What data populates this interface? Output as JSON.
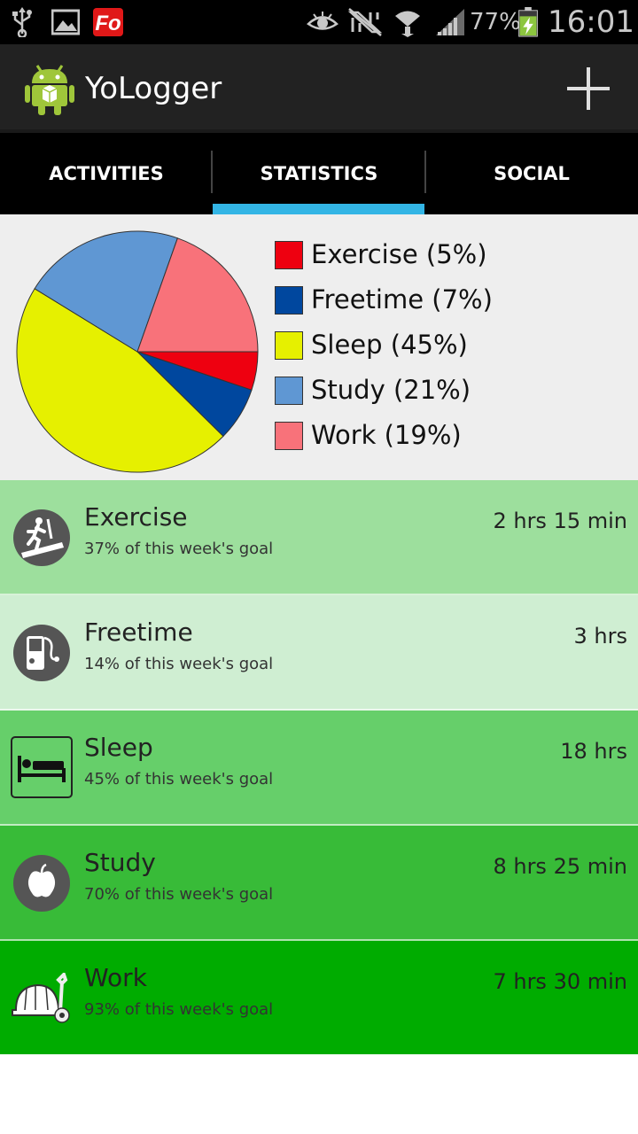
{
  "status_bar": {
    "battery": "77%",
    "time": "16:01",
    "icons": [
      "usb-icon",
      "gallery-icon",
      "fo-app-icon",
      "eye-icon",
      "nfc-icon",
      "wifi-icon",
      "signal-icon",
      "battery-charging-icon"
    ]
  },
  "app": {
    "title": "YoLogger",
    "add_icon": "plus-icon"
  },
  "tabs": [
    {
      "label": "ACTIVITIES",
      "selected": false
    },
    {
      "label": "STATISTICS",
      "selected": true
    },
    {
      "label": "SOCIAL",
      "selected": false
    }
  ],
  "colors": {
    "accent": "#33b5e5",
    "exercise": "#ee0010",
    "freetime": "#00479e",
    "sleep": "#e6f000",
    "study": "#5f97d3",
    "work": "#f8727a"
  },
  "chart_data": {
    "type": "pie",
    "slices": [
      {
        "label": "Exercise (5%)",
        "name": "Exercise",
        "value": 5,
        "color": "#ee0010"
      },
      {
        "label": "Freetime (7%)",
        "name": "Freetime",
        "value": 7,
        "color": "#00479e"
      },
      {
        "label": "Sleep (45%)",
        "name": "Sleep",
        "value": 45,
        "color": "#e6f000"
      },
      {
        "label": "Study (21%)",
        "name": "Study",
        "value": 21,
        "color": "#5f97d3"
      },
      {
        "label": "Work (19%)",
        "name": "Work",
        "value": 19,
        "color": "#f8727a"
      }
    ],
    "legend_position": "right"
  },
  "activities": [
    {
      "name": "Exercise",
      "goal": "37% of this week's goal",
      "time": "2 hrs 15 min",
      "icon": "treadmill-icon",
      "bg": "#9ddf9d"
    },
    {
      "name": "Freetime",
      "goal": "14% of this week's goal",
      "time": "3 hrs",
      "icon": "music-player-icon",
      "bg": "#cfeed2"
    },
    {
      "name": "Sleep",
      "goal": "45% of this week's goal",
      "time": "18 hrs",
      "icon": "bed-icon",
      "bg": "#66cf6a"
    },
    {
      "name": "Study",
      "goal": "70% of this week's goal",
      "time": "8 hrs 25 min",
      "icon": "apple-icon",
      "bg": "#38bb38"
    },
    {
      "name": "Work",
      "goal": "93% of this week's goal",
      "time": "7 hrs 30 min",
      "icon": "hardhat-wrench-icon",
      "bg": "#00ac00"
    }
  ]
}
